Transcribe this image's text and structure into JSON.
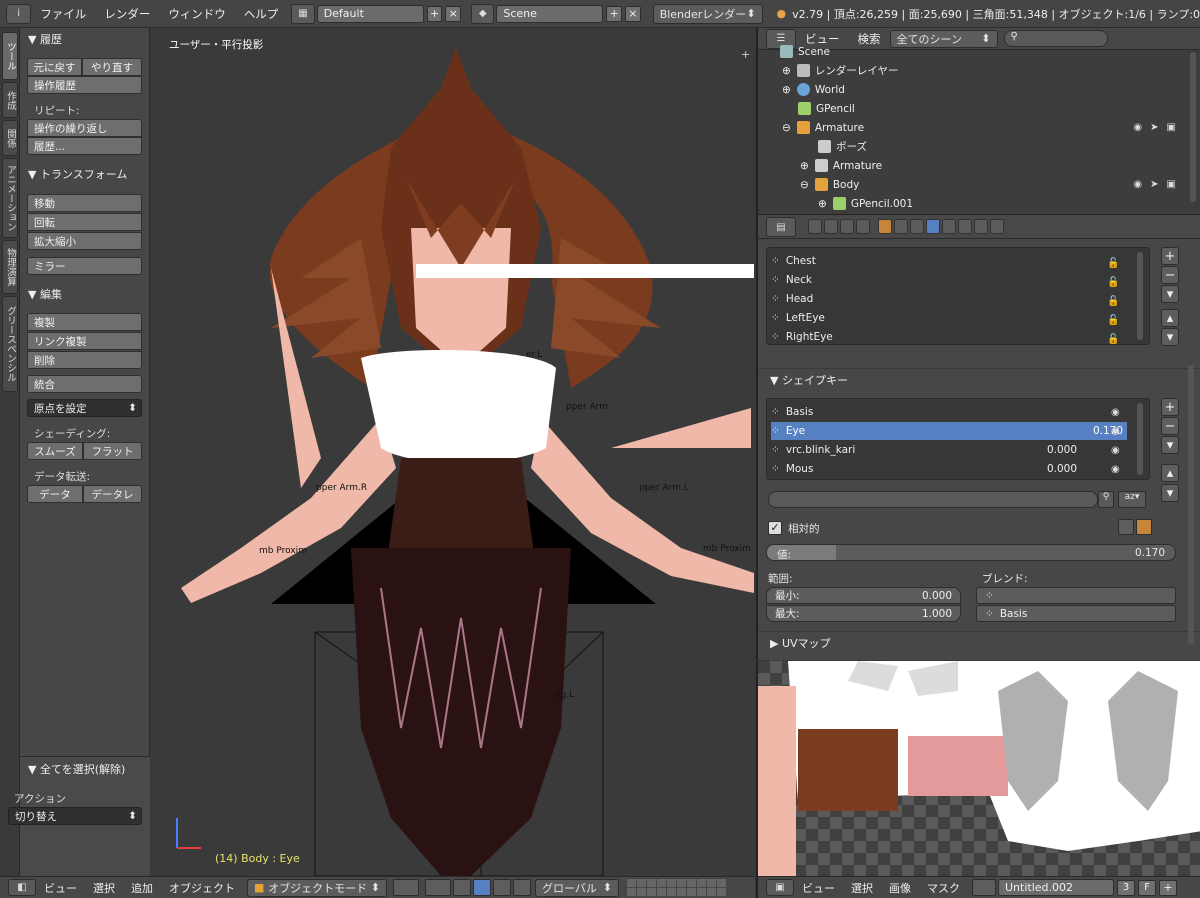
{
  "topbar": {
    "menus": [
      "ファイル",
      "レンダー",
      "ウィンドウ",
      "ヘルプ"
    ],
    "layout": "Default",
    "scene": "Scene",
    "engine": "Blenderレンダー",
    "stats": "v2.79 | 頂点:26,259 | 面:25,690 | 三角面:51,348 | オブジェクト:1/6 | ランプ:0"
  },
  "vtabs": [
    "ツール",
    "作成",
    "関係",
    "アニメーション",
    "物理演算",
    "グリースペンシル"
  ],
  "tools": {
    "history": {
      "title": "▼ 履歴",
      "undo": "元に戻す",
      "redo": "やり直す",
      "undo_history": "操作履歴",
      "repeat_label": "リピート:",
      "repeat_last": "操作の繰り返し",
      "repeat_history": "履歴..."
    },
    "transform": {
      "title": "▼ トランスフォーム",
      "move": "移動",
      "rotate": "回転",
      "scale": "拡大縮小",
      "mirror": "ミラー"
    },
    "edit": {
      "title": "▼ 編集",
      "duplicate": "複製",
      "linked": "リンク複製",
      "delete": "削除",
      "join": "統合",
      "origin": "原点を設定",
      "shading_label": "シェーディング:",
      "smooth": "スムーズ",
      "flat": "フラット",
      "transfer_label": "データ転送:",
      "data": "データ",
      "data_layout": "データレ"
    },
    "operator": {
      "title": "▼ 全てを選択(解除)",
      "action_label": "アクション",
      "action_value": "切り替え"
    }
  },
  "viewport": {
    "title": "ユーザー・平行投影",
    "status": "(14) Body : Eye",
    "bone_labels": [
      "pper Arm.R",
      "pper Arm.L",
      "mb Proxim",
      "mb Proxim",
      "eg.L",
      "er.L",
      "pper Arm"
    ]
  },
  "outliner": {
    "menus": [
      "ビュー",
      "検索"
    ],
    "filter": "全てのシーン",
    "rows": [
      {
        "label": "Scene"
      },
      {
        "label": "レンダーレイヤー"
      },
      {
        "label": "World"
      },
      {
        "label": "GPencil"
      },
      {
        "label": "Armature"
      },
      {
        "label": "ポーズ"
      },
      {
        "label": "Armature"
      },
      {
        "label": "Body"
      },
      {
        "label": "GPencil.001"
      }
    ]
  },
  "properties": {
    "vertex_groups": [
      "Chest",
      "Neck",
      "Head",
      "LeftEye",
      "RightEye"
    ],
    "shape_keys_title": "▼ シェイプキー",
    "shape_keys": [
      {
        "name": "Basis",
        "value": ""
      },
      {
        "name": "Eye",
        "value": "0.170"
      },
      {
        "name": "vrc.blink_kari",
        "value": "0.000"
      },
      {
        "name": "Mous",
        "value": "0.000"
      }
    ],
    "relative_label": "相対的",
    "value_label": "値:",
    "value": "0.170",
    "value_fraction": 0.17,
    "range_label": "範囲:",
    "min_label": "最小:",
    "min_value": "0.000",
    "max_label": "最大:",
    "max_value": "1.000",
    "blend_label": "ブレンド:",
    "blend_value": "Basis",
    "uv_maps_title": "▶ UVマップ"
  },
  "bottom_left": {
    "menus": [
      "ビュー",
      "選択",
      "追加",
      "オブジェクト"
    ],
    "mode": "オブジェクトモード",
    "pivot": "グローバル"
  },
  "bottom_right": {
    "menus": [
      "ビュー",
      "選択",
      "画像",
      "マスク"
    ],
    "image": "Untitled.002",
    "users": "3",
    "fake": "F"
  },
  "colors": {
    "accent": "#5680c2",
    "background": "#393939",
    "panel": "#474747",
    "hair": "#7a3b1f",
    "skin": "#f0b8a8",
    "outfit": "#3a1d17"
  }
}
